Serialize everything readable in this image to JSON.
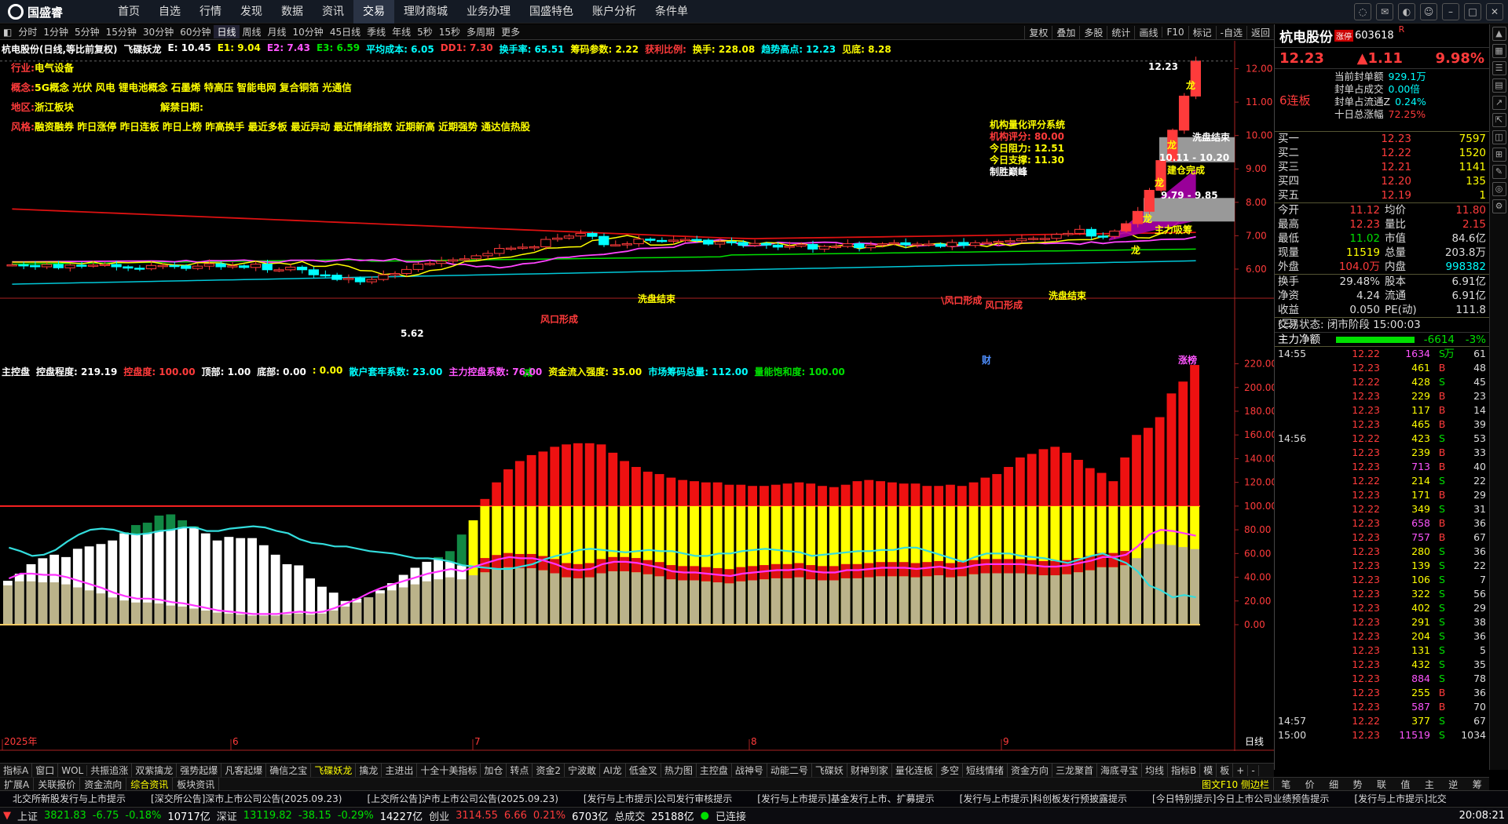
{
  "app": {
    "brand": "国盛睿"
  },
  "menu": [
    "首页",
    "自选",
    "行情",
    "发现",
    "数据",
    "资讯",
    "交易",
    "理财商城",
    "业务办理",
    "国盛特色",
    "账户分析",
    "条件单"
  ],
  "menu_active": "交易",
  "periods": [
    "分时",
    "1分钟",
    "5分钟",
    "15分钟",
    "30分钟",
    "60分钟",
    "日线",
    "周线",
    "月线",
    "10分钟",
    "45日线",
    "季线",
    "年线",
    "5秒",
    "15秒",
    "多周期",
    "更多"
  ],
  "period_selected": "日线",
  "chart_tools": [
    "复权",
    "叠加",
    "多股",
    "统计",
    "画线",
    "F10",
    "标记",
    "-自选",
    "返回"
  ],
  "main_indicator": [
    {
      "t": "杭电股份(日线,等比前复权)",
      "c": "#ffffff"
    },
    {
      "t": "飞碟妖龙",
      "c": "#ffffff"
    },
    {
      "t": "E: 10.45",
      "c": "#ffffff"
    },
    {
      "t": "E1: 9.04",
      "c": "#ffff00"
    },
    {
      "t": "E2: 7.43",
      "c": "#ff55ff"
    },
    {
      "t": "E3: 6.59",
      "c": "#00e000"
    },
    {
      "t": "平均成本: 6.05",
      "c": "#00ffff"
    },
    {
      "t": "DD1: 7.30",
      "c": "#ff3b3b"
    },
    {
      "t": "换手率: 65.51",
      "c": "#00ffff"
    },
    {
      "t": "筹码参数: 2.22",
      "c": "#ffff00"
    },
    {
      "t": "获利比例:",
      "c": "#ff3b3b"
    },
    {
      "t": "换手: 228.08",
      "c": "#ffff00"
    },
    {
      "t": "趋势高点: 12.23",
      "c": "#00ffff"
    },
    {
      "t": "见底: 8.28",
      "c": "#ffff00"
    }
  ],
  "info": {
    "industry_label": "行业:",
    "industry": "电气设备",
    "concept_label": "概念:",
    "concept": "5G概念 光伏 风电 锂电池概念 石墨烯 特高压 智能电网 复合铜箔 光通信",
    "region_label": "地区:",
    "region": "浙江板块",
    "unlock_label": "解禁日期:",
    "style_label": "风格:",
    "style": "融资融券 昨日涨停 昨日连板 昨日上榜 昨高换手 最近多板 最近异动 最近情绪指数 近期新高 近期强势 通达信热股"
  },
  "score": {
    "title": "机构量化评分系统",
    "l1": "机构评分:  80.00",
    "l2": "今日阻力:  12.51",
    "l3": "今日支撑:  11.30",
    "l4": "制胜巅峰"
  },
  "annotations": {
    "high": "12.23",
    "low": "5.62",
    "wash1": "洗盘结束",
    "wash2": "洗盘结束",
    "wash3": "洗盘结束",
    "wind1": "风口形成",
    "wind2": "\\风口形成",
    "wind3": "风口形成",
    "build": "建仓完成",
    "main": "主力吸筹",
    "r1": "10.11 - 10.20",
    "r2": "9.79 - 9.85",
    "dragon": "龙",
    "cai": "财",
    "zhangbang": "涨榜",
    "jian": "减"
  },
  "lower_indicator": [
    {
      "t": "主控盘",
      "c": "#ffffff"
    },
    {
      "t": "控盘程度: 219.19",
      "c": "#ffffff"
    },
    {
      "t": "控盘度: 100.00",
      "c": "#ff3b3b"
    },
    {
      "t": "顶部: 1.00",
      "c": "#ffffff"
    },
    {
      "t": "底部: 0.00",
      "c": "#ffffff"
    },
    {
      "t": ": 0.00",
      "c": "#ffff00"
    },
    {
      "t": "散户套牢系数: 23.00",
      "c": "#00ffff"
    },
    {
      "t": "主力控盘系数: 76.00",
      "c": "#ff55ff"
    },
    {
      "t": "资金流入强度: 35.00",
      "c": "#ffff00"
    },
    {
      "t": "市场筹码总量: 112.00",
      "c": "#00ffff"
    },
    {
      "t": "量能饱和度: 100.00",
      "c": "#00e000"
    }
  ],
  "chart_data": [
    {
      "type": "line",
      "title": "杭电股份(日线,等比前复权)",
      "yticks": [
        6.0,
        7.0,
        8.0,
        9.0,
        10.0,
        11.0,
        12.0
      ],
      "ylim": [
        5.2,
        12.6
      ],
      "xticks": [
        "2025年",
        "6",
        "7",
        "8",
        "9"
      ],
      "x_label_right": "日线",
      "candles_close": [
        6.13,
        6.11,
        6.07,
        6.14,
        6.04,
        6.12,
        6.11,
        6.12,
        6.14,
        6.07,
        6.03,
        6.01,
        6.11,
        6.11,
        6.1,
        6.02,
        6.09,
        6.16,
        6.07,
        6.1,
        6.05,
        6.15,
        5.98,
        5.98,
        6.06,
        5.98,
        5.83,
        5.82,
        5.69,
        5.73,
        5.62,
        5.69,
        5.83,
        5.87,
        5.99,
        6.15,
        6.17,
        6.24,
        6.28,
        6.31,
        6.4,
        6.47,
        6.62,
        6.63,
        6.66,
        6.67,
        6.89,
        6.93,
        6.99,
        7.07,
        6.98,
        6.73,
        6.73,
        6.76,
        6.9,
        6.86,
        6.84,
        6.87,
        6.89,
        6.87,
        6.75,
        6.82,
        6.8,
        6.71,
        6.77,
        6.72,
        6.66,
        6.69,
        6.74,
        6.6,
        6.68,
        6.68,
        6.76,
        6.64,
        6.72,
        6.76,
        6.79,
        6.73,
        6.75,
        6.75,
        6.68,
        6.8,
        6.71,
        6.79,
        6.8,
        6.83,
        6.85,
        6.91,
        6.92,
        6.92,
        7.04,
        7.07,
        7.19,
        6.99,
        6.98,
        7.14,
        7.36,
        7.73,
        8.36,
        9.25,
        10.16,
        11.18,
        12.23
      ],
      "yellow_line_last": 9.04,
      "magenta_line_last": 7.43,
      "green_line_last": 6.59,
      "cyan_line_last": 6.05,
      "red_line_last": 7.3
    },
    {
      "type": "bar",
      "title": "主控盘",
      "yticks": [
        0.0,
        20.0,
        40.0,
        60.0,
        80.0,
        100.0,
        120.0,
        140.0,
        160.0,
        180.0,
        200.0,
        220.0
      ],
      "ylim": [
        0,
        225
      ],
      "reference_line": 100,
      "total": [
        37,
        43,
        51,
        56,
        59,
        57,
        64,
        66,
        68,
        71,
        78,
        84,
        86,
        92,
        93,
        88,
        83,
        77,
        71,
        74,
        73,
        73,
        67,
        59,
        51,
        50,
        39,
        32,
        27,
        20,
        22,
        23,
        29,
        35,
        42,
        48,
        53,
        57,
        62,
        76,
        88,
        106,
        120,
        131,
        138,
        143,
        146,
        150,
        152,
        153,
        153,
        152,
        145,
        138,
        133,
        129,
        127,
        124,
        122,
        121,
        120,
        120,
        118,
        118,
        117,
        117,
        118,
        119,
        120,
        119,
        117,
        116,
        118,
        121,
        122,
        121,
        120,
        119,
        119,
        117,
        117,
        118,
        117,
        120,
        124,
        127,
        133,
        141,
        144,
        148,
        150,
        145,
        139,
        132,
        128,
        121,
        141,
        160,
        166,
        175,
        195,
        205,
        219
      ],
      "cyan": [
        65,
        62,
        58,
        59,
        63,
        70,
        76,
        80,
        81,
        80,
        77,
        76,
        77,
        79,
        80,
        82,
        82,
        79,
        79,
        81,
        82,
        83,
        82,
        79,
        77,
        72,
        69,
        68,
        66,
        66,
        64,
        62,
        61,
        60,
        58,
        56,
        56,
        55,
        53,
        50,
        49,
        48,
        47,
        47,
        49,
        51,
        55,
        58,
        60,
        63,
        64,
        63,
        62,
        61,
        62,
        63,
        62,
        62,
        60,
        58,
        58,
        60,
        60,
        62,
        63,
        64,
        63,
        62,
        61,
        58,
        59,
        60,
        61,
        62,
        62,
        63,
        63,
        65,
        65,
        62,
        59,
        56,
        53,
        57,
        60,
        60,
        60,
        58,
        57,
        56,
        54,
        52,
        55,
        58,
        60,
        56,
        52,
        45,
        33,
        29,
        23,
        25,
        23
      ],
      "magenta": [
        39,
        43,
        43,
        42,
        42,
        40,
        37,
        34,
        31,
        27,
        24,
        22,
        22,
        21,
        19,
        18,
        16,
        14,
        12,
        11,
        10,
        9,
        9,
        9,
        10,
        11,
        10,
        11,
        14,
        18,
        22,
        27,
        31,
        34,
        37,
        40,
        43,
        45,
        47,
        45,
        49,
        52,
        55,
        57,
        56,
        56,
        54,
        51,
        47,
        46,
        47,
        51,
        53,
        53,
        52,
        50,
        48,
        45,
        44,
        44,
        43,
        42,
        41,
        43,
        44,
        45,
        46,
        46,
        47,
        45,
        44,
        44,
        46,
        46,
        47,
        48,
        48,
        48,
        47,
        48,
        49,
        47,
        48,
        50,
        51,
        51,
        51,
        51,
        50,
        49,
        49,
        50,
        52,
        54,
        57,
        57,
        59,
        66,
        76,
        80,
        79,
        77,
        75
      ]
    }
  ],
  "quote": {
    "name": "杭电股份",
    "badge": "涨停",
    "code": "603618",
    "r": "R",
    "price": "12.23",
    "change": "▲1.11",
    "pct": "9.98%",
    "lianban": "6连板",
    "seal": [
      [
        "当前封单额",
        "929.1万"
      ],
      [
        "封单占成交",
        "0.00倍"
      ],
      [
        "封单占流通Z",
        "0.24%"
      ],
      [
        "十日总涨幅",
        "72.25%"
      ]
    ],
    "bids": [
      [
        "买一",
        "12.23",
        "7597"
      ],
      [
        "买二",
        "12.22",
        "1520"
      ],
      [
        "买三",
        "12.21",
        "1141"
      ],
      [
        "买四",
        "12.20",
        "135"
      ],
      [
        "买五",
        "12.19",
        "1"
      ]
    ],
    "stats": [
      [
        "今开",
        "11.12",
        "均价",
        "11.80"
      ],
      [
        "最高",
        "12.23",
        "量比",
        "2.15"
      ],
      [
        "最低",
        "11.02",
        "市值",
        "84.6亿"
      ],
      [
        "现量",
        "11519",
        "总量",
        "203.8万"
      ],
      [
        "外盘",
        "104.0万",
        "内盘",
        "998382"
      ]
    ],
    "stats2": [
      [
        "换手",
        "29.48%",
        "股本",
        "6.91亿"
      ],
      [
        "净资",
        "4.24",
        "流通",
        "6.91亿"
      ],
      [
        "收益(三)",
        "0.050",
        "PE(动)",
        "111.8"
      ]
    ],
    "state": "交易状态: 闭市阶段 15:00:03",
    "netflow_label": "主力净额",
    "netflow": "-6614万",
    "netflow_pct": "-3%"
  },
  "ticks": [
    [
      "14:55",
      "12.22",
      "1634",
      "S",
      "61"
    ],
    [
      "",
      "12.23",
      "461",
      "B",
      "48"
    ],
    [
      "",
      "12.22",
      "428",
      "S",
      "45"
    ],
    [
      "",
      "12.23",
      "229",
      "B",
      "23"
    ],
    [
      "",
      "12.23",
      "117",
      "B",
      "14"
    ],
    [
      "",
      "12.23",
      "465",
      "B",
      "39"
    ],
    [
      "14:56",
      "12.22",
      "423",
      "S",
      "53"
    ],
    [
      "",
      "12.23",
      "239",
      "B",
      "33"
    ],
    [
      "",
      "12.23",
      "713",
      "B",
      "40"
    ],
    [
      "",
      "12.22",
      "214",
      "S",
      "22"
    ],
    [
      "",
      "12.23",
      "171",
      "B",
      "29"
    ],
    [
      "",
      "12.22",
      "349",
      "S",
      "31"
    ],
    [
      "",
      "12.23",
      "658",
      "B",
      "36"
    ],
    [
      "",
      "12.23",
      "757",
      "B",
      "67"
    ],
    [
      "",
      "12.23",
      "280",
      "S",
      "36"
    ],
    [
      "",
      "12.23",
      "139",
      "S",
      "22"
    ],
    [
      "",
      "12.23",
      "106",
      "S",
      "7"
    ],
    [
      "",
      "12.23",
      "322",
      "S",
      "56"
    ],
    [
      "",
      "12.23",
      "402",
      "S",
      "29"
    ],
    [
      "",
      "12.23",
      "291",
      "S",
      "38"
    ],
    [
      "",
      "12.23",
      "204",
      "S",
      "36"
    ],
    [
      "",
      "12.23",
      "131",
      "S",
      "5"
    ],
    [
      "",
      "12.23",
      "432",
      "S",
      "35"
    ],
    [
      "",
      "12.23",
      "884",
      "S",
      "78"
    ],
    [
      "",
      "12.23",
      "255",
      "B",
      "36"
    ],
    [
      "",
      "12.23",
      "587",
      "B",
      "70"
    ],
    [
      "14:57",
      "12.22",
      "377",
      "S",
      "67"
    ],
    [
      "15:00",
      "12.23",
      "11519",
      "S",
      "1034"
    ]
  ],
  "bottom_tabs": [
    "指标A",
    "窗口",
    "WOL",
    "共振追涨",
    "双紫擒龙",
    "强势起爆",
    "凡客起爆",
    "确信之宝",
    "飞碟妖龙",
    "擒龙",
    "主进出",
    "十全十美指标",
    "加仓",
    "转点",
    "资金2",
    "宁波敢",
    "AI龙",
    "低金叉",
    "热力图",
    "主控盘",
    "战神号",
    "动能二号",
    "飞碟妖",
    "财神到家",
    "量化连板",
    "多空",
    "短线情绪",
    "资金方向",
    "三龙聚首",
    "海底寻宝",
    "均线",
    "指标B",
    "模",
    "板",
    "+",
    "-"
  ],
  "bottom_tab_sel": "飞碟妖龙",
  "sub_tabs": [
    "扩展A",
    "关联报价",
    "资金流向",
    "综合资讯",
    "板块资讯"
  ],
  "sub_tab_sel": "综合资讯",
  "right_tabs": [
    "笔",
    "价",
    "细",
    "势",
    "联",
    "值",
    "主",
    "逆",
    "筹"
  ],
  "right_bottom_label": "图文F10 侧边栏",
  "ticker": [
    "北交所新股发行与上市提示",
    "[深交所公告]深市上市公司公告(2025.09.23)",
    "[上交所公告]沪市上市公司公告(2025.09.23)",
    "[发行与上市提示]公司发行审核提示",
    "[发行与上市提示]基金发行上市、扩募提示",
    "[发行与上市提示]科创板发行预披露提示",
    "[今日特别提示]今日上市公司业绩预告提示",
    "[发行与上市提示]北交"
  ],
  "status": {
    "sh": "上证",
    "sh_v": "3821.83",
    "sh_c": "-6.75",
    "sh_p": "-0.18%",
    "sh_a": "10717亿",
    "sz": "深证",
    "sz_v": "13119.82",
    "sz_c": "-38.15",
    "sz_p": "-0.29%",
    "sz_a": "14227亿",
    "cy": "创业",
    "cy_v": "3114.55",
    "cy_c": "6.66",
    "cy_p": "0.21%",
    "cy_a": "6703亿",
    "tot": "总成交",
    "tot_v": "25188亿",
    "conn": "已连接",
    "time": "20:08:21"
  },
  "colors": {
    "up": "#ff3b3b",
    "down": "#00ffff",
    "bg": "#000000",
    "accent": "#ffff00"
  }
}
